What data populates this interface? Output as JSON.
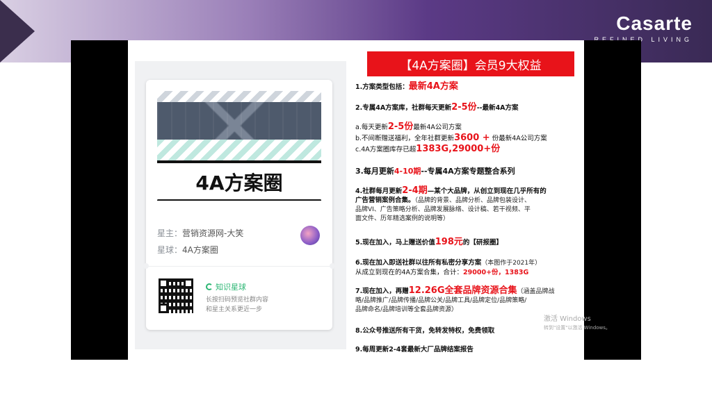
{
  "brand": {
    "name": "Casarte",
    "tagline": "REFINED LIVING"
  },
  "card": {
    "title": "4A方案圈",
    "owner_label": "星主：",
    "owner_value": "营销资源网-大笑",
    "planet_label": "星球：",
    "planet_value": "4A方案圈",
    "app_name": "知识星球",
    "qr_hint_1": "长按扫码预览社群内容",
    "qr_hint_2": "和星主关系更近一步"
  },
  "banner": "【4A方案圈】会员9大权益",
  "items": {
    "i1_a": "1.方案类型包括：",
    "i1_b": "最新4A方案",
    "i2_a": "2.专属4A方案库，社群每天更新",
    "i2_b": "2-5份",
    "i2_c": "--最新4A方案",
    "a_a": "a.每天更新",
    "a_b": "2-5份",
    "a_c": "最新4A公司方案",
    "b_a": "b.不间断赠送福利，全年社群更新",
    "b_b": "3600 +",
    "b_c": " 份最新4A公司方案",
    "c_a": "c.4A方案圈库存已超",
    "c_b": "1383G,29000+份",
    "i3_a": "3.每月更新",
    "i3_b": "4-10期",
    "i3_c": "--专属4A方案专题整合系列",
    "i4_a": "4.社群每月更新",
    "i4_b": "2-4期",
    "i4_c": "—某个大品牌，从创立到现在几乎所有的",
    "i4_d": "广告营销案例合集。",
    "i4_e": "（品牌的背景、品牌分析、品牌包装设计、",
    "i4_f": "品牌VI、广告策略分析、品牌发展脉络、设计稿、若干视频、平",
    "i4_g": "面文件、历年精选案例的说明等）",
    "i5_a": "5.现在加入，马上赠送价值",
    "i5_b": "198元",
    "i5_c": "的【研报圈】",
    "i6_a": "6.现在加入即送社群以往所有私密分享方案",
    "i6_b": "（本图作于2021年）",
    "i6_c": "从成立到现在的4A方案合集，合计：",
    "i6_d": "29000+份，1383G",
    "i7_a": "7.现在加入，再赠",
    "i7_b": "12.26G全套品牌资源合集",
    "i7_c": "（涵盖品牌战",
    "i7_d": "略/品牌推广/品牌传播/品牌公关/品牌工具/品牌定位/品牌策略/",
    "i7_e": "品牌命名/品牌培训等全套品牌资源）",
    "i8": "8.公众号推送所有干货，免转发特权，免费领取",
    "i9": "9.每周更新2-4套最新大厂品牌结案报告"
  },
  "watermark": {
    "line1": "激活 Windows",
    "line2": "转到\"设置\"以激活 Windows。"
  }
}
